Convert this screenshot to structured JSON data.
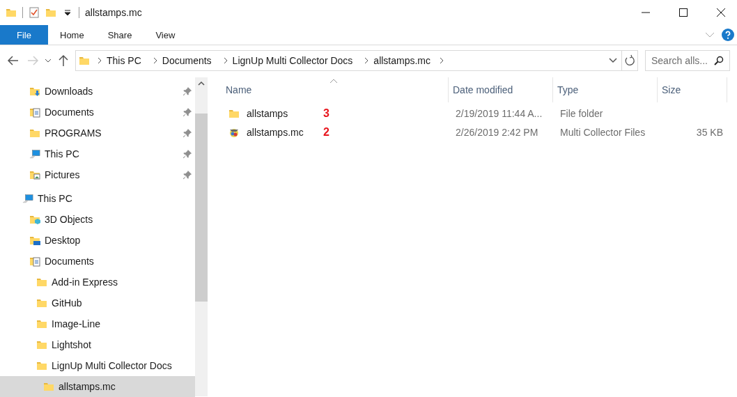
{
  "window": {
    "title": "allstamps.mc"
  },
  "ribbon": {
    "tabs": [
      {
        "label": "File",
        "selected": true
      },
      {
        "label": "Home",
        "selected": false
      },
      {
        "label": "Share",
        "selected": false
      },
      {
        "label": "View",
        "selected": false
      }
    ]
  },
  "address_bar": {
    "path": [
      "This PC",
      "Documents",
      "LignUp Multi Collector Docs",
      "allstamps.mc"
    ]
  },
  "search": {
    "placeholder": "Search alls..."
  },
  "sidebar": {
    "quick_access": [
      {
        "label": "Downloads",
        "kind": "downloads",
        "pinned": true
      },
      {
        "label": "Documents",
        "kind": "documents",
        "pinned": true
      },
      {
        "label": "PROGRAMS",
        "kind": "folder",
        "pinned": true
      },
      {
        "label": "This PC",
        "kind": "pc",
        "pinned": true
      },
      {
        "label": "Pictures",
        "kind": "pictures",
        "pinned": true
      }
    ],
    "tree": [
      {
        "label": "This PC",
        "kind": "pc",
        "selected": false,
        "children": [
          {
            "label": "3D Objects",
            "kind": "objects3d",
            "selected": false
          },
          {
            "label": "Desktop",
            "kind": "desktop",
            "selected": false
          },
          {
            "label": "Documents",
            "kind": "documents",
            "selected": false,
            "children": [
              {
                "label": "Add-in Express",
                "kind": "folder",
                "selected": false
              },
              {
                "label": "GitHub",
                "kind": "folder",
                "selected": false
              },
              {
                "label": "Image-Line",
                "kind": "folder",
                "selected": false
              },
              {
                "label": "Lightshot",
                "kind": "folder",
                "selected": false
              },
              {
                "label": "LignUp Multi Collector Docs",
                "kind": "folder",
                "selected": false,
                "children": [
                  {
                    "label": "allstamps.mc",
                    "kind": "folder",
                    "selected": true
                  }
                ]
              }
            ]
          }
        ]
      }
    ]
  },
  "file_list": {
    "columns": [
      "Name",
      "Date modified",
      "Type",
      "Size"
    ],
    "rows": [
      {
        "name": "allstamps",
        "kind": "folder",
        "annotation": "3",
        "date": "2/19/2019 11:44 A...",
        "type": "File folder",
        "size": ""
      },
      {
        "name": "allstamps.mc",
        "kind": "app",
        "annotation": "2",
        "date": "2/26/2019 2:42 PM",
        "type": "Multi Collector Files",
        "size": "35 KB"
      }
    ]
  }
}
